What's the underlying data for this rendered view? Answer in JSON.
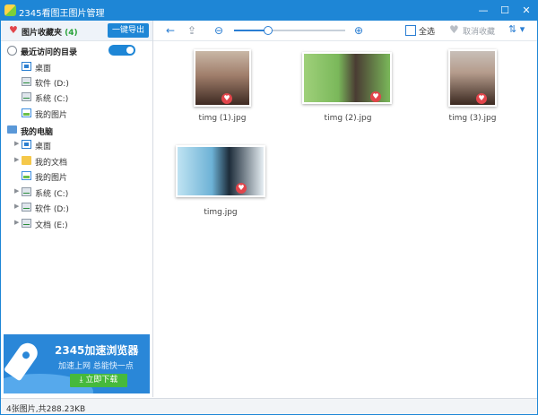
{
  "window": {
    "title": "2345看图王图片管理",
    "controls": {
      "minimize": "—",
      "maximize": "☐",
      "close": "✕"
    }
  },
  "sidebar": {
    "favorites": {
      "label": "图片收藏夹",
      "count": "(4)",
      "export_label": "一键导出"
    },
    "recent": {
      "label": "最近访问的目录",
      "toggle_on": true,
      "items": [
        {
          "label": "桌面",
          "icon": "desktop-icon"
        },
        {
          "label": "软件 (D:)",
          "icon": "drive-icon"
        },
        {
          "label": "系统 (C:)",
          "icon": "drive-icon"
        },
        {
          "label": "我的图片",
          "icon": "picture-icon"
        }
      ]
    },
    "computer": {
      "label": "我的电脑",
      "items": [
        {
          "label": "桌面",
          "icon": "desktop-icon",
          "arrow": "▶"
        },
        {
          "label": "我的文档",
          "icon": "folder-icon",
          "arrow": "▶"
        },
        {
          "label": "我的图片",
          "icon": "picture-icon",
          "arrow": ""
        },
        {
          "label": "系统 (C:)",
          "icon": "drive-icon",
          "arrow": "▶"
        },
        {
          "label": "软件 (D:)",
          "icon": "drive-icon",
          "arrow": "▶"
        },
        {
          "label": "文档 (E:)",
          "icon": "drive-icon",
          "arrow": "▶"
        }
      ]
    }
  },
  "ad": {
    "title": "2345加速浏览器",
    "subtitle": "加速上网 总能快一点",
    "button": "⤓ 立即下载"
  },
  "toolbar": {
    "back": "←",
    "upload": "⇪",
    "zoom_out": "⊖",
    "zoom_in": "⊕",
    "zoom_level": 0.3,
    "select_all": "全选",
    "unfavorite": "取消收藏",
    "sort": "⇅ ▾"
  },
  "files": [
    {
      "name": "timg (1).jpg",
      "favorited": true
    },
    {
      "name": "timg (2).jpg",
      "favorited": true
    },
    {
      "name": "timg (3).jpg",
      "favorited": true
    },
    {
      "name": "timg.jpg",
      "favorited": true
    }
  ],
  "status": {
    "text": "4张图片,共288.23KB"
  },
  "colors": {
    "accent": "#1e86d6",
    "heart": "#e2454b",
    "download": "#46b93c"
  }
}
